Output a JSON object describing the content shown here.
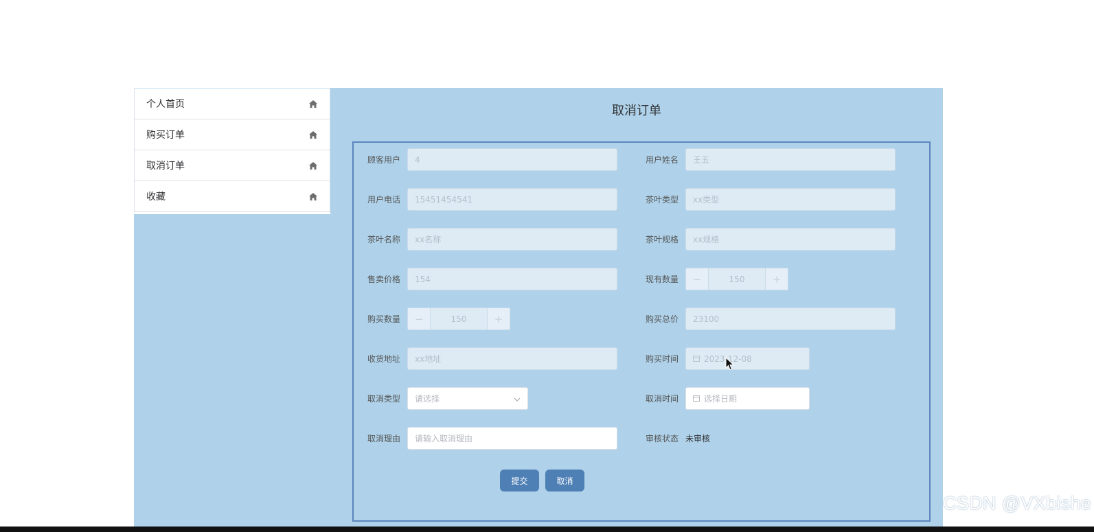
{
  "sidebar": {
    "items": [
      {
        "label": "个人首页"
      },
      {
        "label": "购买订单"
      },
      {
        "label": "取消订单"
      },
      {
        "label": "收藏"
      }
    ]
  },
  "page": {
    "title": "取消订单"
  },
  "form": {
    "customer_user": {
      "label": "顾客用户",
      "value": "4"
    },
    "user_name": {
      "label": "用户姓名",
      "value": "王五"
    },
    "user_phone": {
      "label": "用户电话",
      "value": "15451454541"
    },
    "tea_type": {
      "label": "茶叶类型",
      "value": "xx类型"
    },
    "tea_name": {
      "label": "茶叶名称",
      "value": "xx名称"
    },
    "tea_spec": {
      "label": "茶叶规格",
      "value": "xx规格"
    },
    "sale_price": {
      "label": "售卖价格",
      "value": "154"
    },
    "stock_qty": {
      "label": "现有数量",
      "value": "150",
      "minus": "−",
      "plus": "+"
    },
    "buy_qty": {
      "label": "购买数量",
      "value": "150",
      "minus": "−",
      "plus": "+"
    },
    "buy_total": {
      "label": "购买总价",
      "value": "23100"
    },
    "address": {
      "label": "收货地址",
      "value": "xx地址"
    },
    "buy_time": {
      "label": "购买时间",
      "value": "2023-12-08"
    },
    "cancel_type": {
      "label": "取消类型",
      "placeholder": "请选择"
    },
    "cancel_time": {
      "label": "取消时间",
      "placeholder": "选择日期"
    },
    "cancel_reason": {
      "label": "取消理由",
      "placeholder": "请输入取消理由"
    },
    "review_status": {
      "label": "审核状态",
      "value": "未审核"
    }
  },
  "actions": {
    "submit": "提交",
    "cancel": "取消"
  },
  "watermark": "CSDN @VXbishe",
  "colors": {
    "panel": "#afd2ea",
    "button": "#4e7fb5",
    "border": "#5b86bd"
  }
}
